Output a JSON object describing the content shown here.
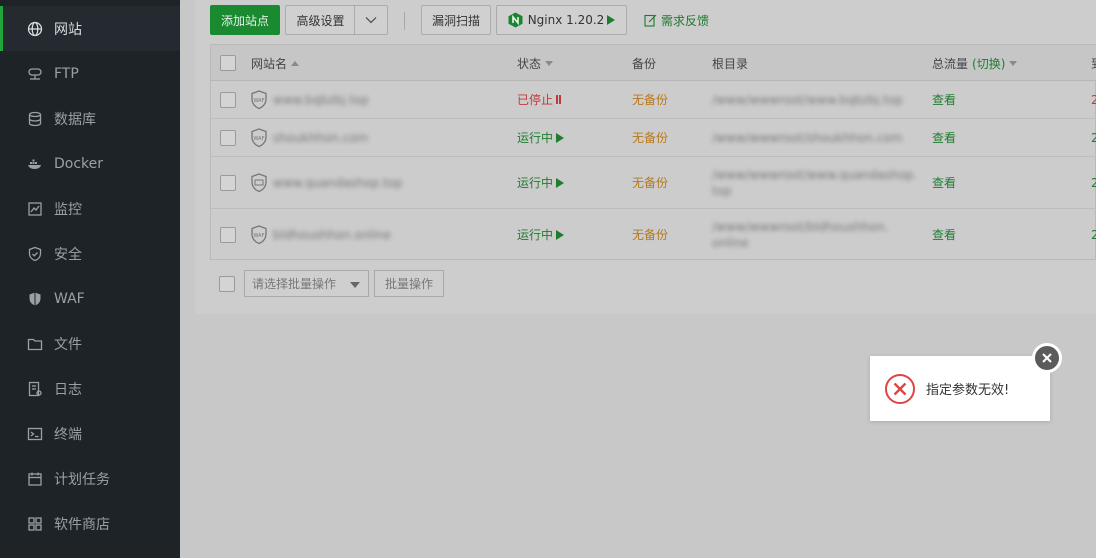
{
  "sidebar": {
    "items": [
      {
        "label": "网站",
        "icon": "globe-icon",
        "active": true
      },
      {
        "label": "FTP",
        "icon": "ftp-icon"
      },
      {
        "label": "数据库",
        "icon": "database-icon"
      },
      {
        "label": "Docker",
        "icon": "docker-icon"
      },
      {
        "label": "监控",
        "icon": "monitor-icon"
      },
      {
        "label": "安全",
        "icon": "shield-check-icon"
      },
      {
        "label": "WAF",
        "icon": "waf-shield-icon"
      },
      {
        "label": "文件",
        "icon": "folder-icon"
      },
      {
        "label": "日志",
        "icon": "log-icon"
      },
      {
        "label": "终端",
        "icon": "terminal-icon"
      },
      {
        "label": "计划任务",
        "icon": "calendar-icon"
      },
      {
        "label": "软件商店",
        "icon": "apps-grid-icon"
      }
    ]
  },
  "toolbar": {
    "add_site": "添加站点",
    "advanced_settings": "高级设置",
    "vuln_scan": "漏洞扫描",
    "nginx_label": "Nginx 1.20.2",
    "feedback": "需求反馈"
  },
  "table": {
    "headers": {
      "site_name": "网站名",
      "status": "状态",
      "backup": "备份",
      "root": "根目录",
      "traffic": "总流量",
      "traffic_switch": "(切换)",
      "edge": "到"
    },
    "rows": [
      {
        "name": "www.bqbzbj.top",
        "status": "已停止",
        "backup": "无备份",
        "root_lines": [
          "/www/wwwroot/www.bqbzbj.top"
        ],
        "traffic": "查看",
        "edge": "2",
        "edge_red": true
      },
      {
        "name": "shoukhhon.com",
        "status": "运行中",
        "backup": "无备份",
        "root_lines": [
          "/www/wwwroot/shoukhhon.com"
        ],
        "traffic": "查看",
        "edge": "2",
        "edge_red": false
      },
      {
        "name": "www.quandashop.top",
        "status": "运行中",
        "backup": "无备份",
        "root_lines": [
          "/www/wwwroot/www.quandashop.",
          "top"
        ],
        "traffic": "查看",
        "edge": "2",
        "edge_red": false
      },
      {
        "name": "bldhoushhon.online",
        "status": "运行中",
        "backup": "无备份",
        "root_lines": [
          "/www/wwwroot/bldhoushhon.",
          "online"
        ],
        "traffic": "查看",
        "edge": "2",
        "edge_red": false
      }
    ]
  },
  "batch": {
    "select_placeholder": "请选择批量操作",
    "button": "批量操作"
  },
  "toast": {
    "message": "指定参数无效!"
  },
  "colors": {
    "sidebar_bg": "#1e2328",
    "accent": "#20a53a",
    "error": "#e04545"
  }
}
